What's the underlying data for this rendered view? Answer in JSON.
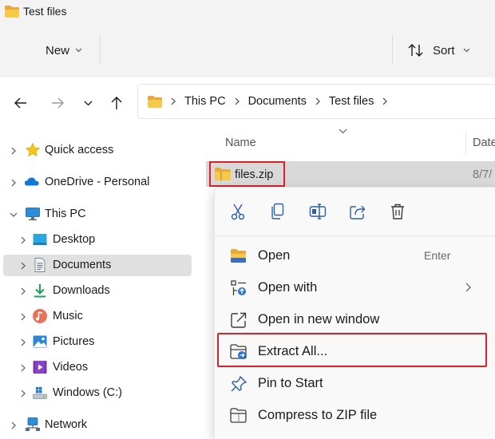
{
  "window": {
    "title": "Test files",
    "title_icon": "folder-icon"
  },
  "command_bar": {
    "new_label": "New",
    "sort_label": "Sort"
  },
  "address": {
    "crumbs": [
      "This PC",
      "Documents",
      "Test files"
    ]
  },
  "nav_tree": {
    "items": [
      {
        "label": "Quick access",
        "icon": "star-icon"
      },
      {
        "label": "OneDrive - Personal",
        "icon": "cloud-icon"
      },
      {
        "label": "This PC",
        "icon": "computer-icon"
      },
      {
        "label": "Desktop",
        "icon": "desktop-icon"
      },
      {
        "label": "Documents",
        "icon": "document-icon",
        "selected": true
      },
      {
        "label": "Downloads",
        "icon": "download-icon"
      },
      {
        "label": "Music",
        "icon": "music-icon"
      },
      {
        "label": "Pictures",
        "icon": "pictures-icon"
      },
      {
        "label": "Videos",
        "icon": "videos-icon"
      },
      {
        "label": "Windows (C:)",
        "icon": "drive-icon"
      },
      {
        "label": "Network",
        "icon": "network-icon"
      }
    ]
  },
  "content": {
    "columns": {
      "name": "Name",
      "date": "Date"
    },
    "files": [
      {
        "name": "files.zip",
        "date": "8/7/",
        "icon": "zip-folder-icon"
      }
    ]
  },
  "context_menu": {
    "quick_actions": [
      "cut-icon",
      "copy-icon",
      "rename-icon",
      "share-icon",
      "delete-icon"
    ],
    "items": [
      {
        "label": "Open",
        "shortcut": "Enter",
        "icon": "open-folder-icon"
      },
      {
        "label": "Open with",
        "icon": "open-with-icon",
        "has_submenu": true
      },
      {
        "label": "Open in new window",
        "icon": "new-window-icon"
      },
      {
        "label": "Extract All...",
        "icon": "extract-icon",
        "highlighted": true
      },
      {
        "label": "Pin to Start",
        "icon": "pin-icon"
      },
      {
        "label": "Compress to ZIP file",
        "icon": "compress-icon"
      }
    ]
  },
  "colors": {
    "highlight": "#d9202b",
    "accent": "#0067c0",
    "folder": "#f3c24a"
  }
}
